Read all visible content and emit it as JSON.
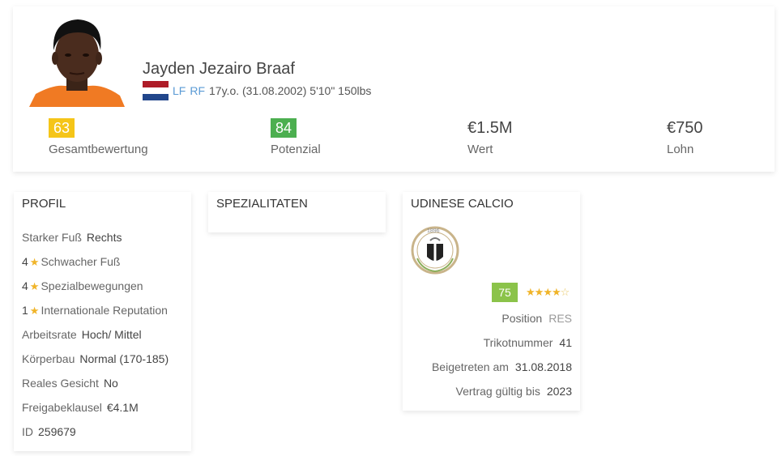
{
  "player": {
    "name": "Jayden Jezairo Braaf",
    "positions": [
      "LF",
      "RF"
    ],
    "details": "17y.o. (31.08.2002) 5'10\" 150lbs",
    "flag_icon": "netherlands-flag-icon"
  },
  "stats": [
    {
      "value": "63",
      "label": "Gesamtbewertung",
      "color": "#f5c518",
      "badge": true
    },
    {
      "value": "84",
      "label": "Potenzial",
      "color": "#4caf50",
      "badge": true
    },
    {
      "value": "€1.5M",
      "label": "Wert",
      "badge": false
    },
    {
      "value": "€750",
      "label": "Lohn",
      "badge": false
    }
  ],
  "profile": {
    "title": "PROFIL",
    "strong_foot_label": "Starker Fuß",
    "strong_foot_value": "Rechts",
    "weak_foot_value": "4",
    "weak_foot_label": "Schwacher Fuß",
    "skill_moves_value": "4",
    "skill_moves_label": "Spezialbewegungen",
    "intl_rep_value": "1",
    "intl_rep_label": "Internationale Reputation",
    "work_rate_label": "Arbeitsrate",
    "work_rate_value": "Hoch/ Mittel",
    "body_label": "Körperbau",
    "body_value": "Normal (170-185)",
    "real_face_label": "Reales Gesicht",
    "real_face_value": "No",
    "release_label": "Freigabeklausel",
    "release_value": "€4.1M",
    "id_label": "ID",
    "id_value": "259679"
  },
  "specialities": {
    "title": "SPEZIALITATEN"
  },
  "club": {
    "title": "UDINESE CALCIO",
    "crest_text": "1896",
    "rating": "75",
    "rating_color": "#8bc34a",
    "stars": 4,
    "position_label": "Position",
    "position_value": "RES",
    "jersey_label": "Trikotnummer",
    "jersey_value": "41",
    "joined_label": "Beigetreten am",
    "joined_value": "31.08.2018",
    "contract_label": "Vertrag gültig bis",
    "contract_value": "2023"
  },
  "colors": {
    "accent_blue": "#5b9bd5",
    "star": "#f0b429"
  }
}
